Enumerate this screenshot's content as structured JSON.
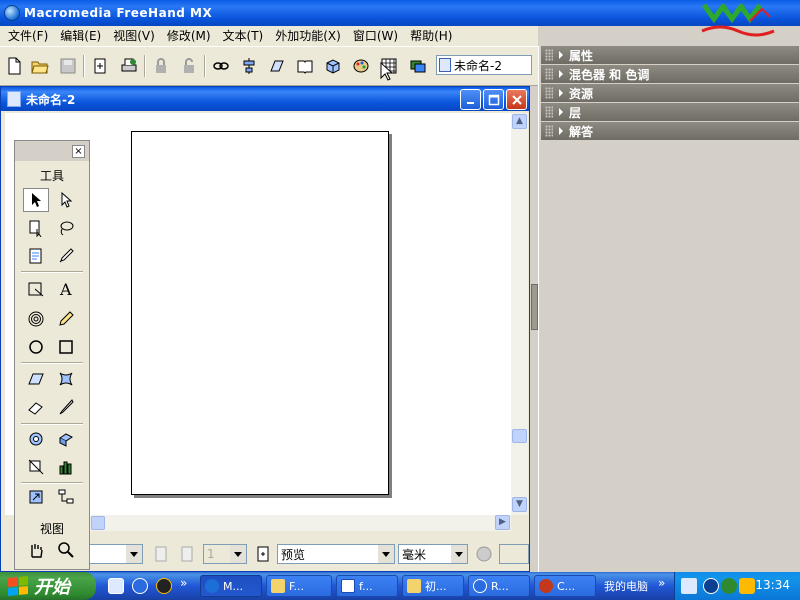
{
  "app": {
    "title": "Macromedia FreeHand MX"
  },
  "menu": {
    "items": [
      "文件(F)",
      "编辑(E)",
      "视图(V)",
      "修改(M)",
      "文本(T)",
      "外加功能(X)",
      "窗口(W)",
      "帮助(H)"
    ]
  },
  "toolbar": {
    "doc_dropdown_value": "未命名-2"
  },
  "panels": {
    "items": [
      "属性",
      "混色器 和 色调",
      "资源",
      "层",
      "解答"
    ]
  },
  "document": {
    "title": "未命名-2"
  },
  "tools": {
    "header": "工具",
    "view_header": "视图"
  },
  "statusbar": {
    "page_value": "1",
    "render_mode": "预览",
    "units": "毫米"
  },
  "taskbar": {
    "start_label": "开始",
    "tasks": [
      "M...",
      "F...",
      "f...",
      "初...",
      "R...",
      "C..."
    ],
    "my_computer": "我的电脑",
    "clock": "13:34"
  },
  "colors": {
    "titlebar": "#0a55dc",
    "panel_header": "#7a776f",
    "taskbar": "#245edb",
    "start": "#3c8f3c"
  }
}
